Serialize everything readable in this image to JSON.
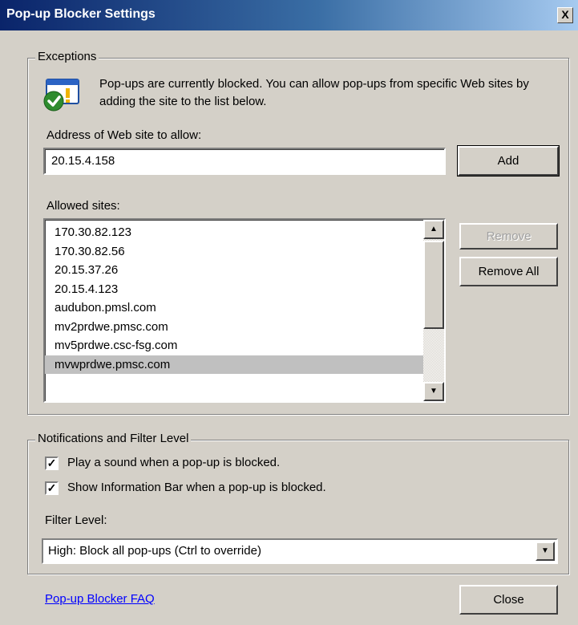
{
  "window": {
    "title": "Pop-up Blocker Settings",
    "close_glyph": "X"
  },
  "exceptions": {
    "legend": "Exceptions",
    "info_text": "Pop-ups are currently blocked.  You can allow pop-ups from specific Web sites by adding the site to the list below.",
    "address_label": "Address of Web site to allow:",
    "address_value": "20.15.4.158",
    "add_label": "Add",
    "allowed_label": "Allowed sites:",
    "allowed_sites": [
      "170.30.82.123",
      "170.30.82.56",
      "20.15.37.26",
      "20.15.4.123",
      "audubon.pmsl.com",
      "mv2prdwe.pmsc.com",
      "mv5prdwe.csc-fsg.com",
      "mvwprdwe.pmsc.com"
    ],
    "selected_index": 7,
    "remove_label": "Remove",
    "remove_all_label": "Remove All"
  },
  "notifications": {
    "legend": "Notifications and Filter Level",
    "play_sound_label": "Play a sound when a pop-up is blocked.",
    "play_sound_checked": true,
    "info_bar_label": "Show Information Bar when a pop-up is blocked.",
    "info_bar_checked": true,
    "filter_label": "Filter Level:",
    "filter_value": "High: Block all pop-ups (Ctrl to override)"
  },
  "footer": {
    "faq_link": "Pop-up Blocker FAQ",
    "close_label": "Close"
  },
  "icons": {
    "info": "shield-check-icon",
    "scroll_up": "arrow-up-icon",
    "scroll_down": "arrow-down-icon",
    "dropdown": "chevron-down-icon"
  }
}
